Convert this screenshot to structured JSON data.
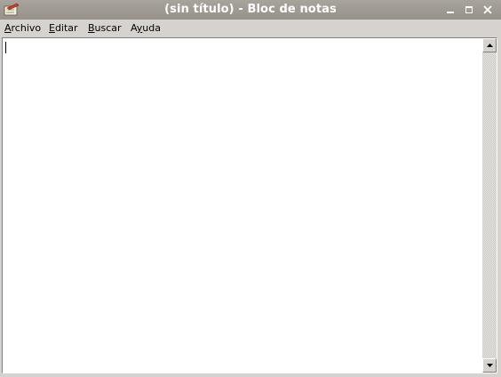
{
  "window": {
    "title": "(sin título) - Bloc de notas"
  },
  "icons": {
    "app": "notepad-icon",
    "minimize": "minimize-icon",
    "maximize": "maximize-icon",
    "close": "close-icon",
    "scroll_up": "arrow-up-icon",
    "scroll_down": "arrow-down-icon"
  },
  "menu": {
    "archivo": {
      "mnemonic": "A",
      "rest": "rchivo"
    },
    "editar": {
      "mnemonic": "E",
      "rest": "ditar"
    },
    "buscar": {
      "mnemonic": "B",
      "rest": "uscar"
    },
    "ayuda": {
      "pre": "A",
      "mnemonic": "y",
      "rest": "uda"
    }
  },
  "editor": {
    "content": ""
  },
  "colors": {
    "titlebar": "#9e9a92",
    "title_text": "#ffffff",
    "chrome": "#d6d3ce",
    "editor_bg": "#ffffff"
  }
}
